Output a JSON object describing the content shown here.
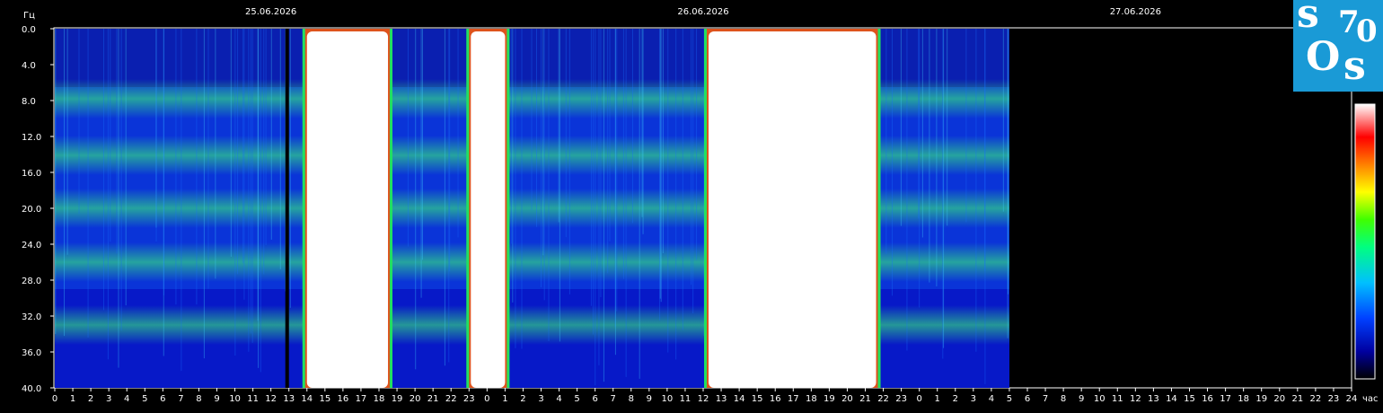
{
  "chart_data": {
    "type": "heatmap",
    "title": "",
    "y_unit_label": "Гц",
    "x_unit_label": "час",
    "ylim": [
      0,
      40
    ],
    "y_ticks": [
      "0.0",
      "4.0",
      "8.0",
      "12.0",
      "16.0",
      "20.0",
      "24.0",
      "28.0",
      "32.0",
      "36.0",
      "40.0"
    ],
    "dates": [
      "25.06.2026",
      "26.06.2026",
      "27.06.2026"
    ],
    "x_ticks": [
      "0",
      "1",
      "2",
      "3",
      "4",
      "5",
      "6",
      "7",
      "8",
      "9",
      "10",
      "11",
      "12",
      "13",
      "14",
      "15",
      "16",
      "17",
      "18",
      "19",
      "20",
      "21",
      "22",
      "23",
      "0",
      "1",
      "2",
      "3",
      "4",
      "5",
      "6",
      "7",
      "8",
      "9",
      "10",
      "11",
      "12",
      "13",
      "14",
      "15",
      "16",
      "17",
      "18",
      "19",
      "20",
      "21",
      "22",
      "23",
      "0",
      "1",
      "2",
      "3",
      "4",
      "5",
      "6",
      "7",
      "8",
      "9",
      "10",
      "11",
      "12",
      "13",
      "14",
      "15",
      "16",
      "17",
      "18",
      "19",
      "20",
      "21",
      "22",
      "23",
      "24"
    ],
    "data_range_hours": [
      0,
      53
    ],
    "resonance_bands_hz": [
      7.8,
      14.1,
      20.0,
      26.0,
      33.0
    ],
    "saturated_intervals_hours": [
      [
        14.0,
        18.5
      ],
      [
        23.1,
        25.0
      ],
      [
        36.3,
        45.6
      ]
    ],
    "dropout_intervals_hours": [
      [
        12.8,
        13.0
      ]
    ],
    "colorbar_colors": [
      "#000000",
      "#0000a0",
      "#0040ff",
      "#00c0ff",
      "#00ff80",
      "#40ff00",
      "#ffff00",
      "#ff8000",
      "#ff0000",
      "#ffffff"
    ]
  },
  "logo": {
    "chars": [
      "s",
      "7",
      "0",
      "O",
      "s"
    ]
  }
}
